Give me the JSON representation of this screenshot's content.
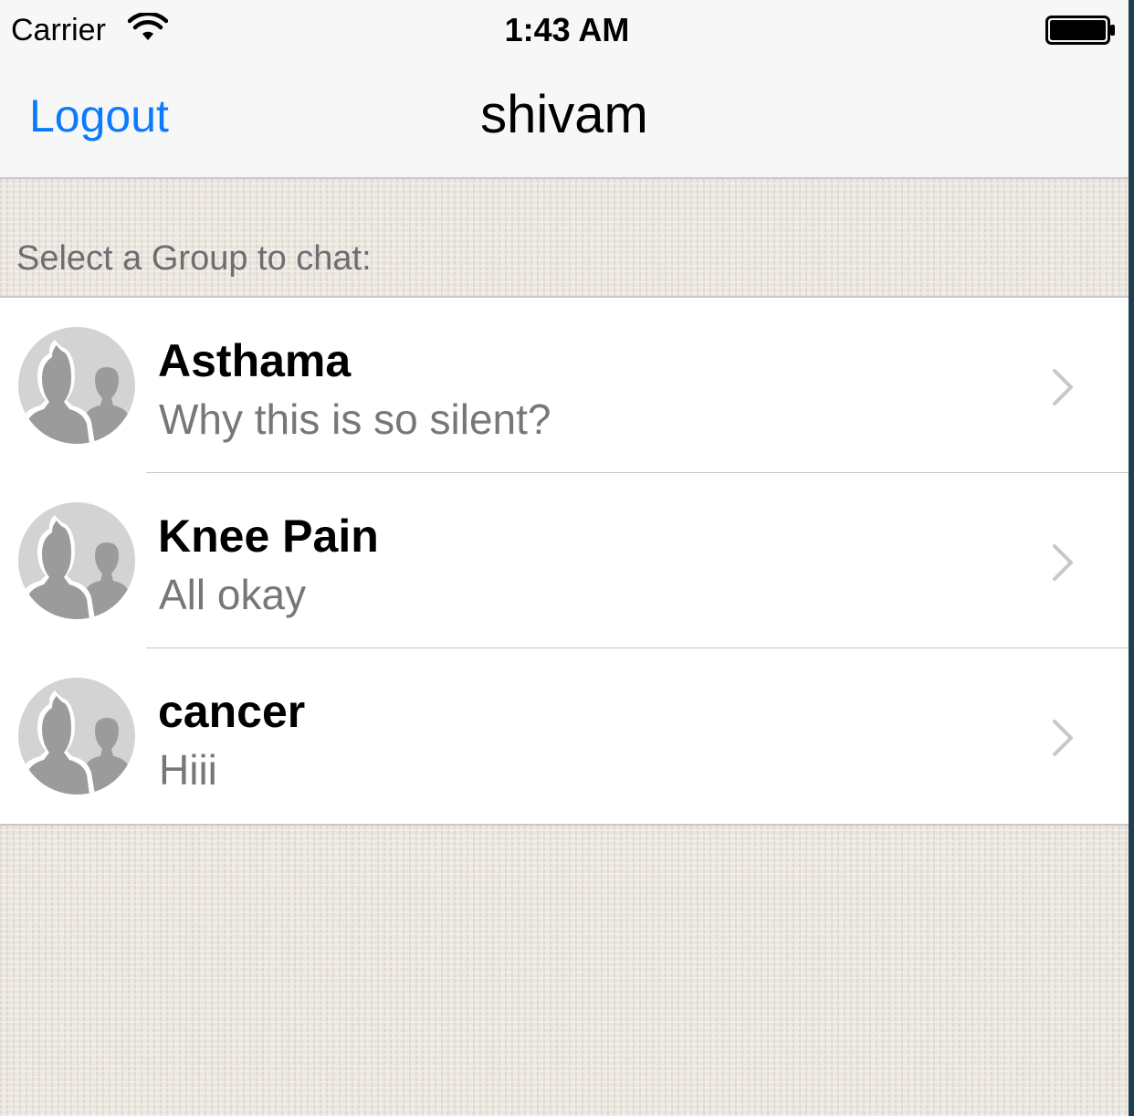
{
  "status_bar": {
    "carrier": "Carrier",
    "time": "1:43 AM"
  },
  "nav_bar": {
    "left_button": "Logout",
    "title": "shivam"
  },
  "section": {
    "header": "Select a Group to chat:"
  },
  "groups": [
    {
      "name": "Asthama",
      "last_message": "Why this is so silent?"
    },
    {
      "name": "Knee Pain",
      "last_message": "All okay"
    },
    {
      "name": "cancer",
      "last_message": "Hiii"
    }
  ],
  "colors": {
    "tint": "#0a7bfd",
    "subtitle": "#777777",
    "avatar_bg": "#d3d3d3",
    "avatar_figure": "#9b9b9b"
  },
  "icons": [
    "wifi-icon",
    "battery-icon",
    "group-avatar-icon",
    "chevron-right-icon"
  ]
}
